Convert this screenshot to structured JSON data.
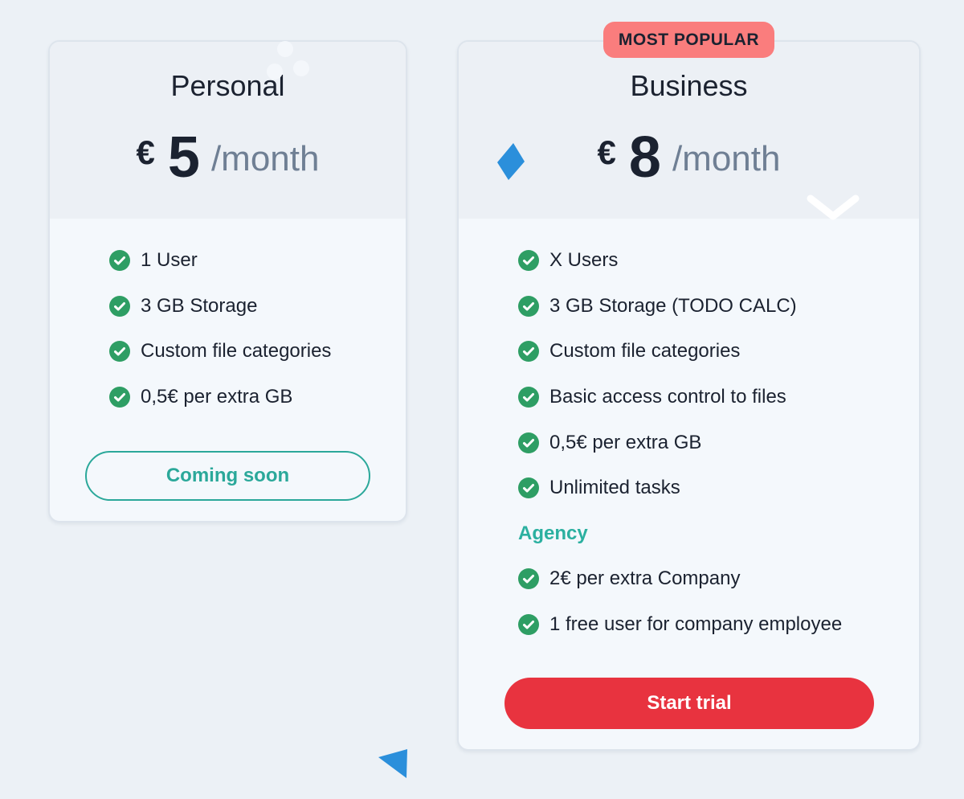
{
  "colors": {
    "background": "#ecf1f6",
    "accent_teal": "#2ba89a",
    "primary_red": "#e8333f",
    "badge_pink": "#fa7d7d",
    "check_green": "#2e9e64"
  },
  "plans": [
    {
      "name": "Personal",
      "currency": "€",
      "amount": "5",
      "period": "/month",
      "features": [
        "1 User",
        "3 GB Storage",
        "Custom file categories",
        "0,5€ per extra GB"
      ],
      "button_label": "Coming soon"
    },
    {
      "badge": "MOST POPULAR",
      "name": "Business",
      "currency": "€",
      "amount": "8",
      "period": "/month",
      "features": [
        "X Users",
        "3 GB Storage (TODO CALC)",
        "Custom file categories",
        "Basic access control to files",
        "0,5€ per extra GB",
        "Unlimited tasks"
      ],
      "section_label": "Agency",
      "section_features": [
        "2€ per extra Company",
        "1 free user for company employee"
      ],
      "button_label": "Start trial"
    }
  ]
}
